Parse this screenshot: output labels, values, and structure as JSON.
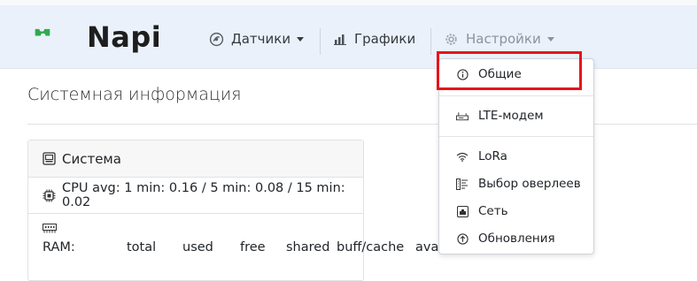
{
  "navbar": {
    "brand": "Napi",
    "items": [
      {
        "label": "Датчики",
        "icon": "sensor-icon"
      },
      {
        "label": "Графики",
        "icon": "bar-chart-icon"
      },
      {
        "label": "Настройки",
        "icon": "gear-icon"
      }
    ]
  },
  "page": {
    "title": "Системная информация"
  },
  "card": {
    "header": "Система",
    "cpu": "CPU avg: 1 min: 0.16 / 5 min: 0.08 / 15 min: 0.02",
    "ram_columns": [
      "RAM:",
      "total",
      "used",
      "free",
      "shared",
      "buff/cache",
      "available"
    ]
  },
  "dropdown": {
    "items": [
      {
        "label": "Общие",
        "icon": "info-icon"
      },
      {
        "label": "LTE-модем",
        "icon": "modem-icon"
      },
      {
        "label": "LoRa",
        "icon": "wifi-icon"
      },
      {
        "label": "Выбор оверлеев",
        "icon": "overlay-icon"
      },
      {
        "label": "Сеть",
        "icon": "network-icon"
      },
      {
        "label": "Обновления",
        "icon": "update-icon"
      }
    ]
  },
  "colors": {
    "navbar_bg": "#eaf1fb",
    "logo_green": "#2eaa4e",
    "highlight": "#e8121c"
  }
}
